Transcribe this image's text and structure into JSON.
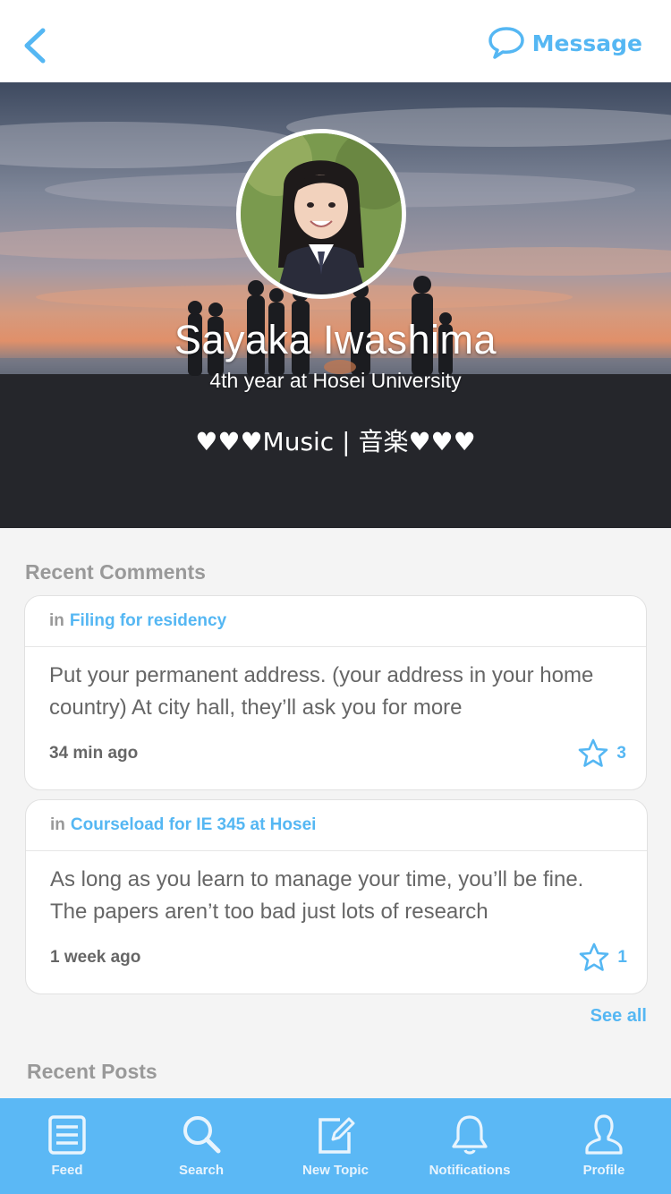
{
  "topbar": {
    "back_icon": "chevron-left-icon",
    "message_label": "Message",
    "message_icon": "chat-bubble-icon",
    "accent": "#55b7f3"
  },
  "profile": {
    "name": "Sayaka Iwashima",
    "subtitle": "4th year at Hosei University",
    "bio": "♥♥♥Music | 音楽♥♥♥"
  },
  "recent_comments": {
    "title": "Recent Comments",
    "items": [
      {
        "prefix": "in",
        "topic": "Filing for residency",
        "body": "Put your permanent address. (your address in your home country) At city hall, they’ll ask you for more",
        "time": "34 min ago",
        "stars": "3"
      },
      {
        "prefix": "in",
        "topic": "Courseload for IE 345 at Hosei",
        "body": "As long as you learn to manage your time, you’ll be fine. The papers aren’t too bad just lots of research",
        "time": "1 week ago",
        "stars": "1"
      }
    ],
    "see_all": "See all"
  },
  "recent_posts": {
    "title": "Recent Posts"
  },
  "tabbar": {
    "background": "#5bb8f5",
    "tabs": [
      {
        "label": "Feed",
        "icon": "feed-icon"
      },
      {
        "label": "Search",
        "icon": "search-icon"
      },
      {
        "label": "New Topic",
        "icon": "compose-icon"
      },
      {
        "label": "Notifications",
        "icon": "bell-icon"
      },
      {
        "label": "Profile",
        "icon": "person-icon"
      }
    ]
  }
}
